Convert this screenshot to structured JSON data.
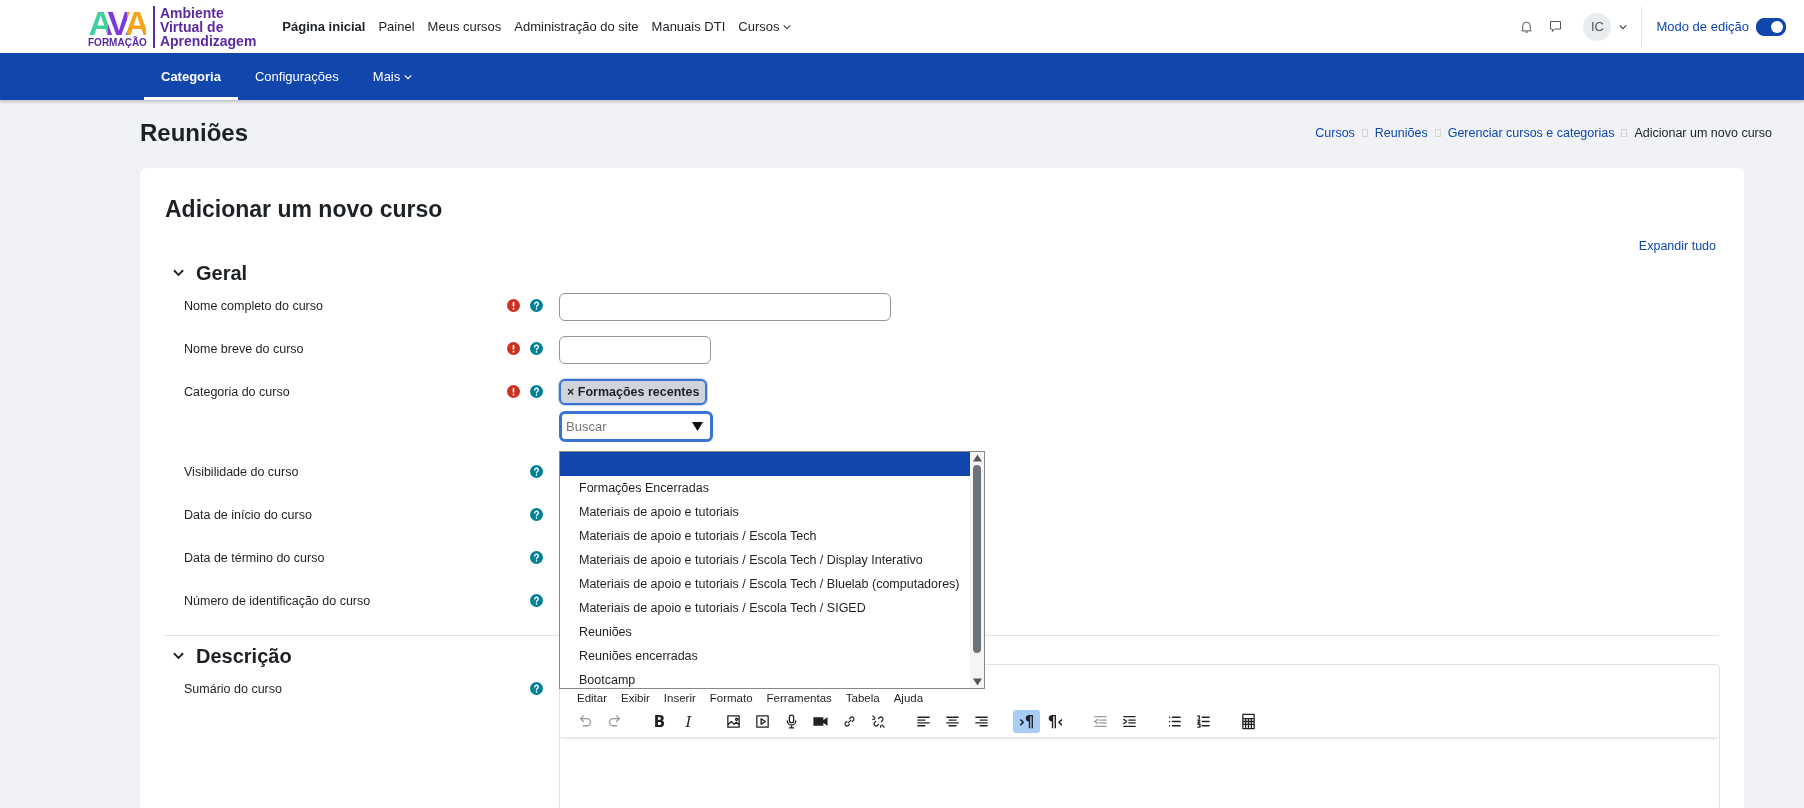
{
  "logo": {
    "mark": "AVA",
    "sub": "FORMAÇÃO",
    "name_lines": [
      "Ambiente",
      "Virtual de",
      "Aprendizagem"
    ]
  },
  "nav": [
    {
      "label": "Página inicial",
      "selected": true,
      "dropdown": false
    },
    {
      "label": "Painel",
      "selected": false,
      "dropdown": false
    },
    {
      "label": "Meus cursos",
      "selected": false,
      "dropdown": false
    },
    {
      "label": "Administração do site",
      "selected": false,
      "dropdown": false
    },
    {
      "label": "Manuais DTI",
      "selected": false,
      "dropdown": false
    },
    {
      "label": "Cursos",
      "selected": false,
      "dropdown": true
    }
  ],
  "user": {
    "initials": "IC"
  },
  "edit_mode": {
    "label": "Modo de edição",
    "on": true
  },
  "secondary_nav": [
    {
      "label": "Categoria",
      "selected": true,
      "dropdown": false
    },
    {
      "label": "Configurações",
      "selected": false,
      "dropdown": false
    },
    {
      "label": "Mais",
      "selected": false,
      "dropdown": true
    }
  ],
  "page_title": "Reuniões",
  "breadcrumb": [
    {
      "label": "Cursos",
      "link": true
    },
    {
      "label": "Reuniões",
      "link": true
    },
    {
      "label": "Gerenciar cursos e categorias",
      "link": true
    },
    {
      "label": "Adicionar um novo curso",
      "link": false
    }
  ],
  "heading": "Adicionar um novo curso",
  "expand_all": "Expandir tudo",
  "sections": [
    {
      "title": "Geral",
      "expanded": true,
      "fields": [
        {
          "label": "Nome completo do curso",
          "required": true,
          "kind": "long-text"
        },
        {
          "label": "Nome breve do curso",
          "required": true,
          "kind": "short-text"
        },
        {
          "label": "Categoria do curso",
          "required": true,
          "kind": "autocomplete",
          "chip": "× Formações recentes",
          "placeholder": "Buscar",
          "options": [
            {
              "selected": true
            },
            {
              "label": "Formações Encerradas",
              "selected": false
            },
            {
              "label": "Materiais de apoio e tutoriais",
              "selected": false
            },
            {
              "label": "Materiais de apoio e tutoriais / Escola Tech",
              "selected": false
            },
            {
              "label": "Materiais de apoio e tutoriais / Escola Tech / Display Interativo",
              "selected": false
            },
            {
              "label": "Materiais de apoio e tutoriais / Escola Tech / Bluelab (computadores)",
              "selected": false
            },
            {
              "label": "Materiais de apoio e tutoriais / Escola Tech / SIGED",
              "selected": false
            },
            {
              "label": "Reuniões",
              "selected": false
            },
            {
              "label": "Reuniões encerradas",
              "selected": false
            },
            {
              "label": "Bootcamp",
              "selected": false
            }
          ]
        },
        {
          "label": "Visibilidade do curso",
          "required": false,
          "kind": "covered"
        },
        {
          "label": "Data de início do curso",
          "required": false,
          "kind": "covered"
        },
        {
          "label": "Data de término do curso",
          "required": false,
          "kind": "covered"
        },
        {
          "label": "Número de identificação do curso",
          "required": false,
          "kind": "covered"
        }
      ]
    },
    {
      "title": "Descrição",
      "expanded": true,
      "fields": [
        {
          "label": "Sumário do curso",
          "required": false,
          "kind": "editor",
          "menu": [
            "Editar",
            "Exibir",
            "Inserir",
            "Formato",
            "Ferramentas",
            "Tabela",
            "Ajuda"
          ],
          "tool_groups": [
            [
              {
                "kind": "undo",
                "disabled": true,
                "active": false
              },
              {
                "kind": "redo",
                "disabled": true,
                "active": false
              }
            ],
            [
              {
                "kind": "bold",
                "label": "B",
                "disabled": false,
                "active": false
              },
              {
                "kind": "italic",
                "label": "I",
                "disabled": false,
                "active": false
              }
            ],
            [
              {
                "kind": "image",
                "disabled": false,
                "active": false
              },
              {
                "kind": "media",
                "disabled": false,
                "active": false
              },
              {
                "kind": "mic",
                "disabled": false,
                "active": false
              },
              {
                "kind": "video",
                "disabled": false,
                "active": false
              },
              {
                "kind": "link",
                "disabled": false,
                "active": false
              },
              {
                "kind": "unlink",
                "disabled": false,
                "active": false
              }
            ],
            [
              {
                "kind": "align-left",
                "disabled": false,
                "active": false
              },
              {
                "kind": "align-center",
                "disabled": false,
                "active": false
              },
              {
                "kind": "align-right",
                "disabled": false,
                "active": false
              }
            ],
            [
              {
                "kind": "ltr",
                "label": "›¶",
                "disabled": false,
                "active": true
              },
              {
                "kind": "rtl",
                "label": "¶‹",
                "disabled": false,
                "active": false
              }
            ],
            [
              {
                "kind": "outdent",
                "disabled": true,
                "active": false
              },
              {
                "kind": "indent",
                "disabled": false,
                "active": false
              }
            ],
            [
              {
                "kind": "bullets",
                "disabled": false,
                "active": false
              },
              {
                "kind": "numbers",
                "disabled": false,
                "active": false
              }
            ],
            [
              {
                "kind": "calculator",
                "disabled": false,
                "active": false
              }
            ]
          ]
        }
      ]
    }
  ]
}
